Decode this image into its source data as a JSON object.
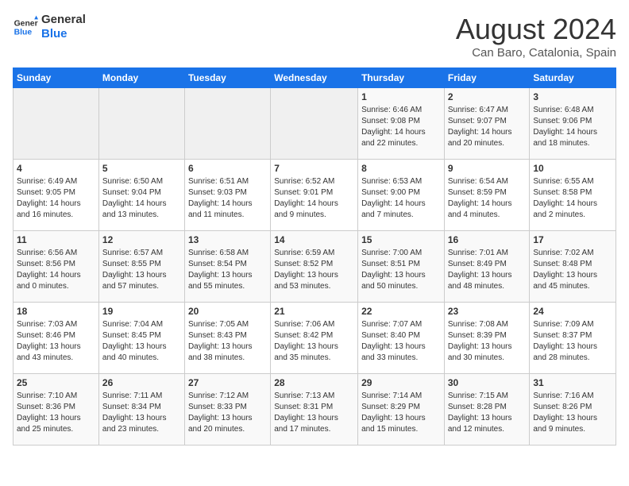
{
  "logo": {
    "line1": "General",
    "line2": "Blue"
  },
  "title": "August 2024",
  "subtitle": "Can Baro, Catalonia, Spain",
  "weekdays": [
    "Sunday",
    "Monday",
    "Tuesday",
    "Wednesday",
    "Thursday",
    "Friday",
    "Saturday"
  ],
  "weeks": [
    [
      {
        "day": "",
        "info": ""
      },
      {
        "day": "",
        "info": ""
      },
      {
        "day": "",
        "info": ""
      },
      {
        "day": "",
        "info": ""
      },
      {
        "day": "1",
        "info": "Sunrise: 6:46 AM\nSunset: 9:08 PM\nDaylight: 14 hours\nand 22 minutes."
      },
      {
        "day": "2",
        "info": "Sunrise: 6:47 AM\nSunset: 9:07 PM\nDaylight: 14 hours\nand 20 minutes."
      },
      {
        "day": "3",
        "info": "Sunrise: 6:48 AM\nSunset: 9:06 PM\nDaylight: 14 hours\nand 18 minutes."
      }
    ],
    [
      {
        "day": "4",
        "info": "Sunrise: 6:49 AM\nSunset: 9:05 PM\nDaylight: 14 hours\nand 16 minutes."
      },
      {
        "day": "5",
        "info": "Sunrise: 6:50 AM\nSunset: 9:04 PM\nDaylight: 14 hours\nand 13 minutes."
      },
      {
        "day": "6",
        "info": "Sunrise: 6:51 AM\nSunset: 9:03 PM\nDaylight: 14 hours\nand 11 minutes."
      },
      {
        "day": "7",
        "info": "Sunrise: 6:52 AM\nSunset: 9:01 PM\nDaylight: 14 hours\nand 9 minutes."
      },
      {
        "day": "8",
        "info": "Sunrise: 6:53 AM\nSunset: 9:00 PM\nDaylight: 14 hours\nand 7 minutes."
      },
      {
        "day": "9",
        "info": "Sunrise: 6:54 AM\nSunset: 8:59 PM\nDaylight: 14 hours\nand 4 minutes."
      },
      {
        "day": "10",
        "info": "Sunrise: 6:55 AM\nSunset: 8:58 PM\nDaylight: 14 hours\nand 2 minutes."
      }
    ],
    [
      {
        "day": "11",
        "info": "Sunrise: 6:56 AM\nSunset: 8:56 PM\nDaylight: 14 hours\nand 0 minutes."
      },
      {
        "day": "12",
        "info": "Sunrise: 6:57 AM\nSunset: 8:55 PM\nDaylight: 13 hours\nand 57 minutes."
      },
      {
        "day": "13",
        "info": "Sunrise: 6:58 AM\nSunset: 8:54 PM\nDaylight: 13 hours\nand 55 minutes."
      },
      {
        "day": "14",
        "info": "Sunrise: 6:59 AM\nSunset: 8:52 PM\nDaylight: 13 hours\nand 53 minutes."
      },
      {
        "day": "15",
        "info": "Sunrise: 7:00 AM\nSunset: 8:51 PM\nDaylight: 13 hours\nand 50 minutes."
      },
      {
        "day": "16",
        "info": "Sunrise: 7:01 AM\nSunset: 8:49 PM\nDaylight: 13 hours\nand 48 minutes."
      },
      {
        "day": "17",
        "info": "Sunrise: 7:02 AM\nSunset: 8:48 PM\nDaylight: 13 hours\nand 45 minutes."
      }
    ],
    [
      {
        "day": "18",
        "info": "Sunrise: 7:03 AM\nSunset: 8:46 PM\nDaylight: 13 hours\nand 43 minutes."
      },
      {
        "day": "19",
        "info": "Sunrise: 7:04 AM\nSunset: 8:45 PM\nDaylight: 13 hours\nand 40 minutes."
      },
      {
        "day": "20",
        "info": "Sunrise: 7:05 AM\nSunset: 8:43 PM\nDaylight: 13 hours\nand 38 minutes."
      },
      {
        "day": "21",
        "info": "Sunrise: 7:06 AM\nSunset: 8:42 PM\nDaylight: 13 hours\nand 35 minutes."
      },
      {
        "day": "22",
        "info": "Sunrise: 7:07 AM\nSunset: 8:40 PM\nDaylight: 13 hours\nand 33 minutes."
      },
      {
        "day": "23",
        "info": "Sunrise: 7:08 AM\nSunset: 8:39 PM\nDaylight: 13 hours\nand 30 minutes."
      },
      {
        "day": "24",
        "info": "Sunrise: 7:09 AM\nSunset: 8:37 PM\nDaylight: 13 hours\nand 28 minutes."
      }
    ],
    [
      {
        "day": "25",
        "info": "Sunrise: 7:10 AM\nSunset: 8:36 PM\nDaylight: 13 hours\nand 25 minutes."
      },
      {
        "day": "26",
        "info": "Sunrise: 7:11 AM\nSunset: 8:34 PM\nDaylight: 13 hours\nand 23 minutes."
      },
      {
        "day": "27",
        "info": "Sunrise: 7:12 AM\nSunset: 8:33 PM\nDaylight: 13 hours\nand 20 minutes."
      },
      {
        "day": "28",
        "info": "Sunrise: 7:13 AM\nSunset: 8:31 PM\nDaylight: 13 hours\nand 17 minutes."
      },
      {
        "day": "29",
        "info": "Sunrise: 7:14 AM\nSunset: 8:29 PM\nDaylight: 13 hours\nand 15 minutes."
      },
      {
        "day": "30",
        "info": "Sunrise: 7:15 AM\nSunset: 8:28 PM\nDaylight: 13 hours\nand 12 minutes."
      },
      {
        "day": "31",
        "info": "Sunrise: 7:16 AM\nSunset: 8:26 PM\nDaylight: 13 hours\nand 9 minutes."
      }
    ]
  ]
}
